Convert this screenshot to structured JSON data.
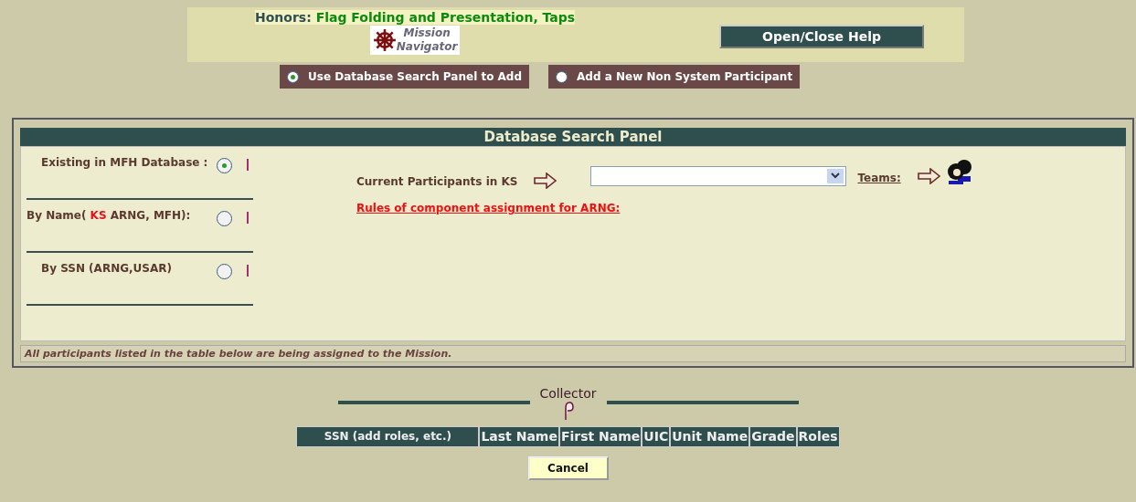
{
  "header": {
    "title_label": "Honors:",
    "title": "Flag Folding and Presentation, Taps",
    "logo_lines": [
      "Mission",
      "Navigator"
    ],
    "help_button": "Open/Close Help"
  },
  "add_modes": [
    {
      "label": "Use Database Search Panel to Add",
      "selected": true
    },
    {
      "label": "Add a New Non System Participant",
      "selected": false
    }
  ],
  "search_panel": {
    "title": "Database Search Panel",
    "search_options": [
      {
        "label": "Existing in MFH Database :",
        "selected": true
      },
      {
        "prefix": "By Name(",
        "highlight": "KS",
        "suffix": "ARNG, MFH):",
        "selected": false
      },
      {
        "label": "By SSN (ARNG,USAR)",
        "selected": false
      }
    ],
    "participants_label": "Current Participants in KS",
    "teams_link": "Teams:",
    "rules_link": "Rules of component assignment for ARNG:",
    "footer_note": "All participants listed in the table below are being assigned to the Mission."
  },
  "collector": {
    "title": "Collector",
    "columns": [
      "SSN (add roles, etc.)",
      "Last Name",
      "First Name",
      "UIC",
      "Unit Name",
      "Grade",
      "Roles"
    ]
  },
  "cancel_button": "Cancel"
}
